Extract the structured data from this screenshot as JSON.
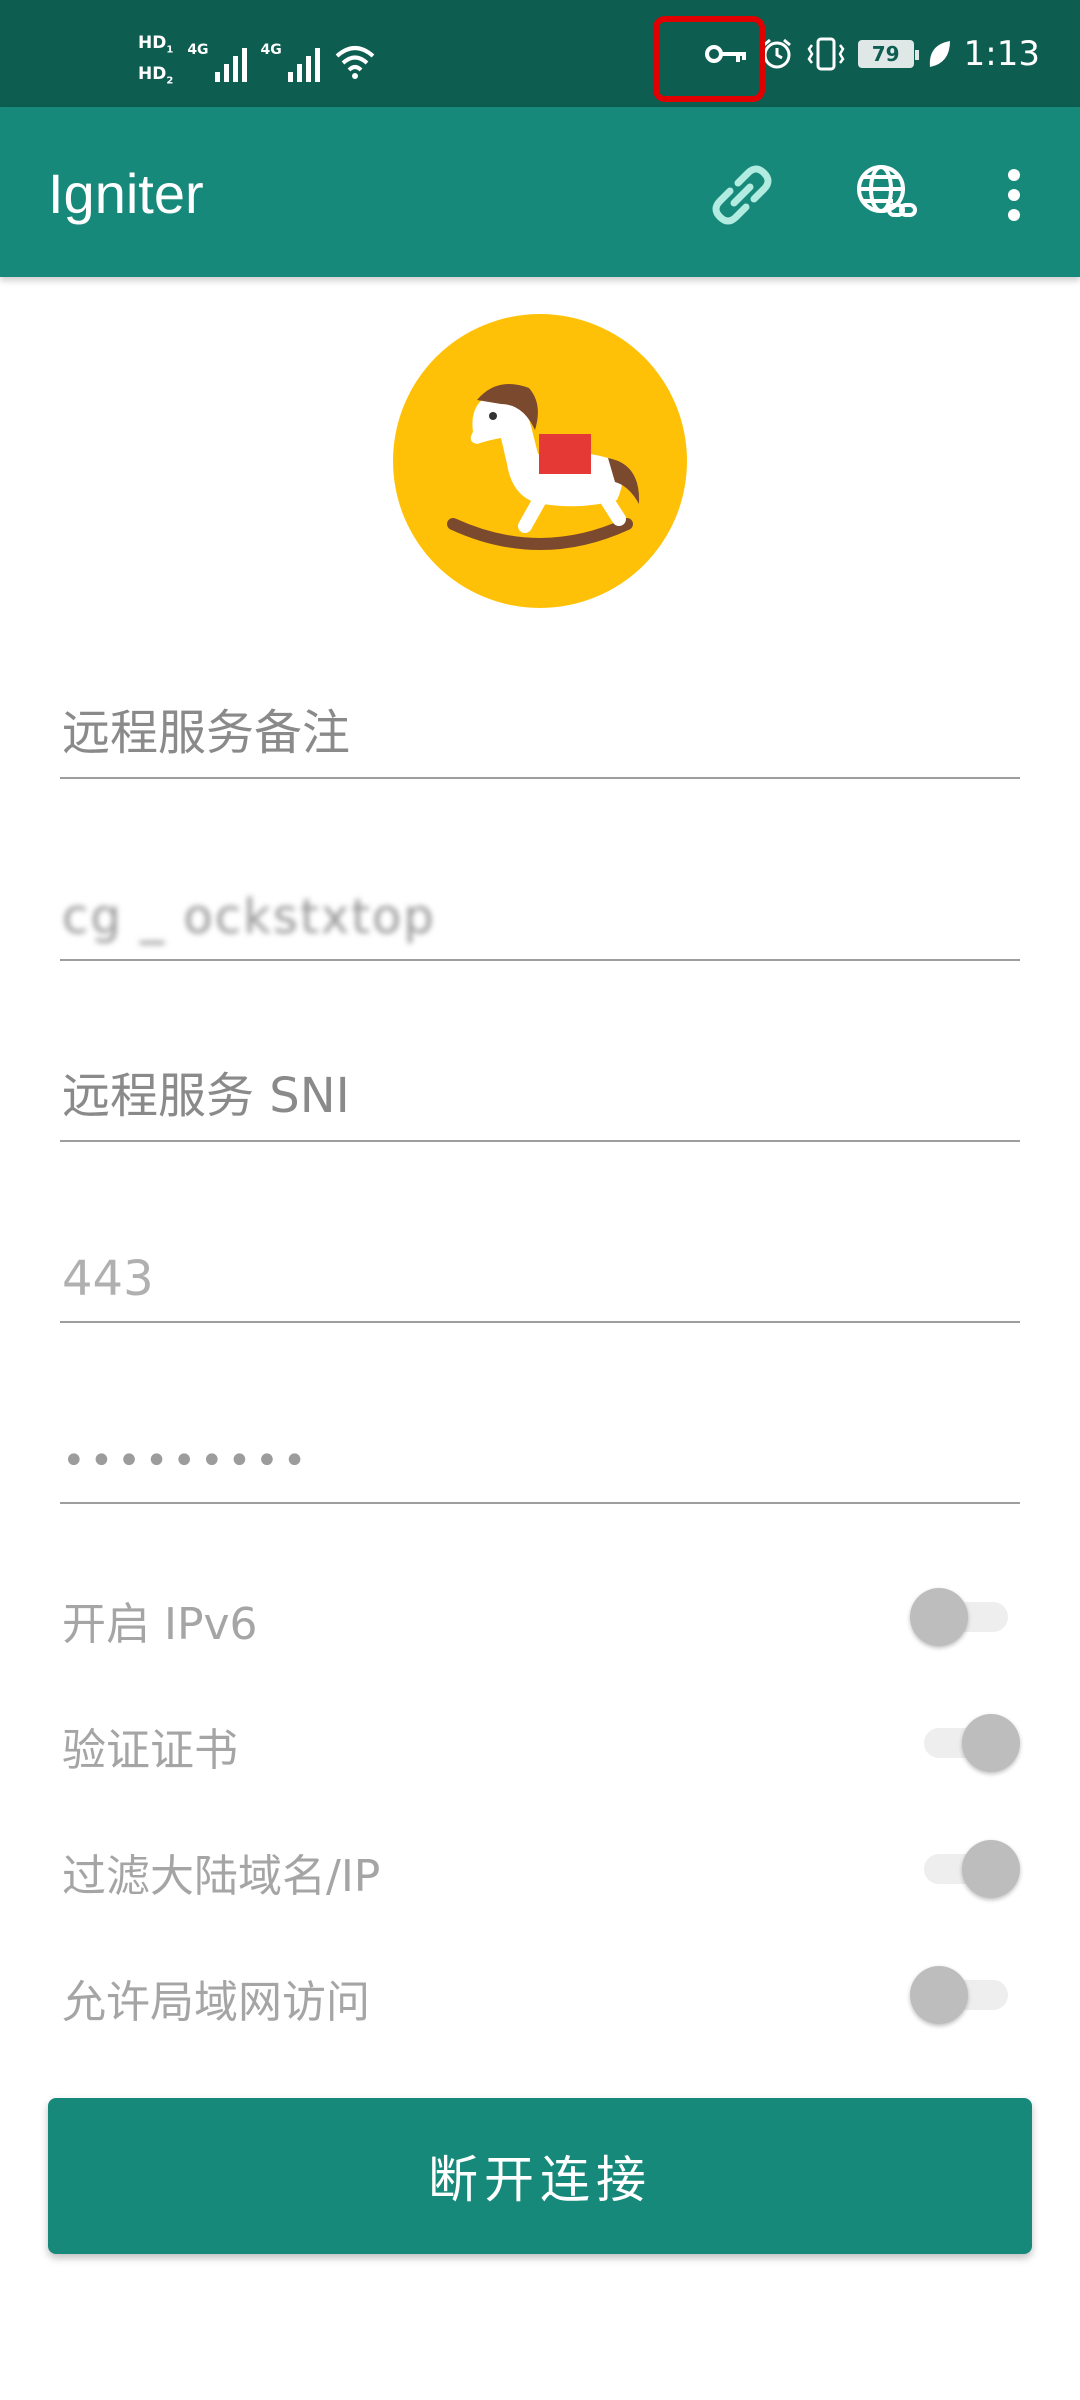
{
  "status_bar": {
    "hd1": "HD",
    "hd1_sub": "1",
    "hd2": "HD",
    "hd2_sub": "2",
    "net1": "4G",
    "net2": "4G",
    "battery": "79",
    "time": "1:13",
    "icons": [
      "signal-icon",
      "wifi-icon",
      "vpn-key-icon",
      "alarm-icon",
      "vibrate-icon",
      "battery-icon",
      "power-saver-leaf-icon"
    ]
  },
  "app_bar": {
    "title": "Igniter",
    "icons": [
      "link-icon",
      "globe-link-icon",
      "more-vert-icon"
    ]
  },
  "logo": {
    "icon": "rocking-horse-icon",
    "color": "#ffc107"
  },
  "form": {
    "remark_placeholder": "远程服务备注",
    "address_value": "cg _ ockstxtop",
    "sni_placeholder": "远程服务 SNI",
    "port_placeholder": "443",
    "password_value": "•••••••••"
  },
  "toggles": [
    {
      "label": "开启 IPv6",
      "state": "off"
    },
    {
      "label": "验证证书",
      "state": "on"
    },
    {
      "label": "过滤大陆域名/IP",
      "state": "on"
    },
    {
      "label": "允许局域网访问",
      "state": "off"
    }
  ],
  "primary_button": {
    "label": "断开连接"
  },
  "colors": {
    "status_bar": "#0d5d51",
    "app_bar": "#16897a",
    "highlight": "#e00000"
  }
}
